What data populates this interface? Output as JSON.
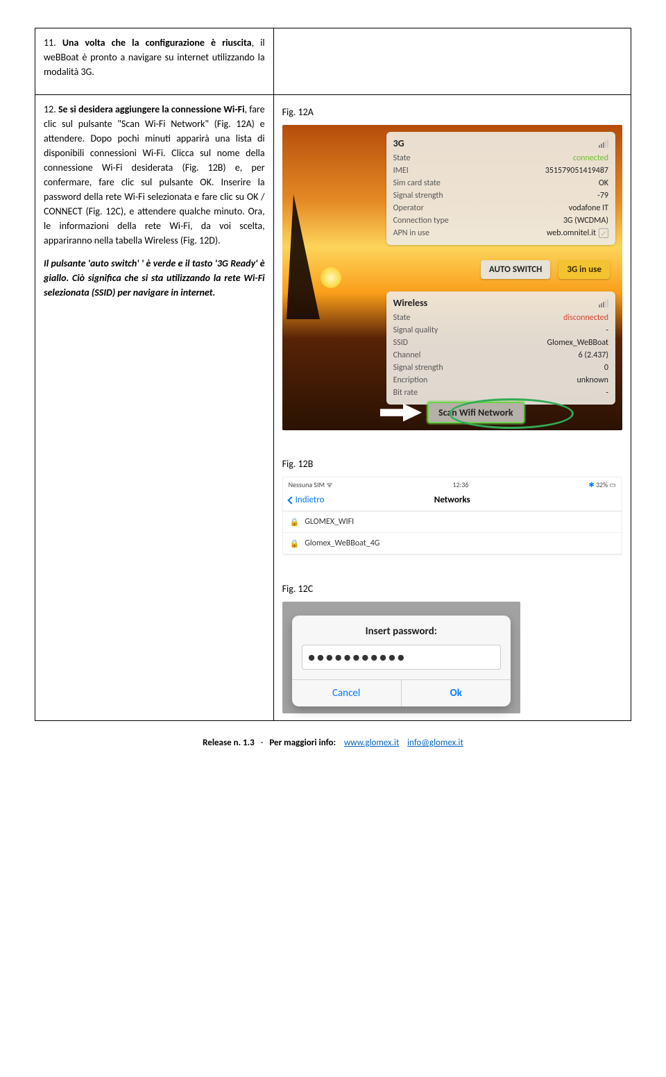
{
  "row1": {
    "para": "11. Una volta che la configurazione è riuscita, il weBBoat è pronto a navigare su internet utilizzando la modalità 3G."
  },
  "row2": {
    "left": {
      "para1": "12. Se si desidera aggiungere la connessione Wi-Fi, fare clic sul pulsante \"Scan Wi-Fi Network\" (Fig. 12A) e attendere. Dopo pochi minuti apparirà una lista di disponibili connessioni Wi-Fi. Clicca sul nome della connessione Wi-Fi desiderata (Fig. 12B) e, per confermare, fare clic sul pulsante OK. Inserire la password della rete Wi-Fi selezionata e fare clic su OK / CONNECT (Fig. 12C), e attendere qualche minuto. Ora, le informazioni della rete Wi-Fi, da voi scelta, appariranno nella tabella Wireless (Fig. 12D).",
      "para2": "Il pulsante 'auto switch' ' è verde e il tasto '3G Ready' è giallo. Ciò significa che si sta utilizzando la rete Wi-Fi selezionata (SSID) per navigare in internet."
    },
    "right": {
      "fig12a": {
        "label": "Fig. 12A",
        "panel3g": {
          "title": "3G",
          "rows": {
            "state_k": "State",
            "state_v": "connected",
            "imei_k": "IMEI",
            "imei_v": "351579051419487",
            "sim_k": "Sim card state",
            "sim_v": "OK",
            "sig_k": "Signal strength",
            "sig_v": "-79",
            "op_k": "Operator",
            "op_v": "vodafone IT",
            "ct_k": "Connection type",
            "ct_v": "3G (WCDMA)",
            "apn_k": "APN in use",
            "apn_v": "web.omnitel.it"
          }
        },
        "btn_auto": "AUTO SWITCH",
        "btn_3g": "3G in use",
        "panel_wl": {
          "title": "Wireless",
          "rows": {
            "state_k": "State",
            "state_v": "disconnected",
            "sq_k": "Signal quality",
            "sq_v": "-",
            "ssid_k": "SSID",
            "ssid_v": "Glomex_WeBBoat",
            "ch_k": "Channel",
            "ch_v": "6 (2.437)",
            "ss_k": "Signal strength",
            "ss_v": "0",
            "enc_k": "Encription",
            "enc_v": "unknown",
            "br_k": "Bit rate",
            "br_v": "-"
          }
        },
        "scan_btn": "Scan Wifi Network"
      },
      "fig12b": {
        "label": "Fig. 12B",
        "status_left": "Nessuna SIM",
        "status_time": "12:36",
        "status_batt": "32%",
        "back": "Indietro",
        "title": "Networks",
        "items": [
          "GLOMEX_WIFI",
          "Glomex_WeBBoat_4G"
        ]
      },
      "fig12c": {
        "label": "Fig. 12C",
        "title": "Insert password:",
        "pw": "●●●●●●●●●●●",
        "cancel": "Cancel",
        "ok": "Ok"
      }
    }
  },
  "footer": {
    "release": "Release n. 1.3",
    "sep": "-",
    "moreinfo": "Per maggiori info:",
    "url": "www.glomex.it",
    "email": "info@glomex.it"
  }
}
